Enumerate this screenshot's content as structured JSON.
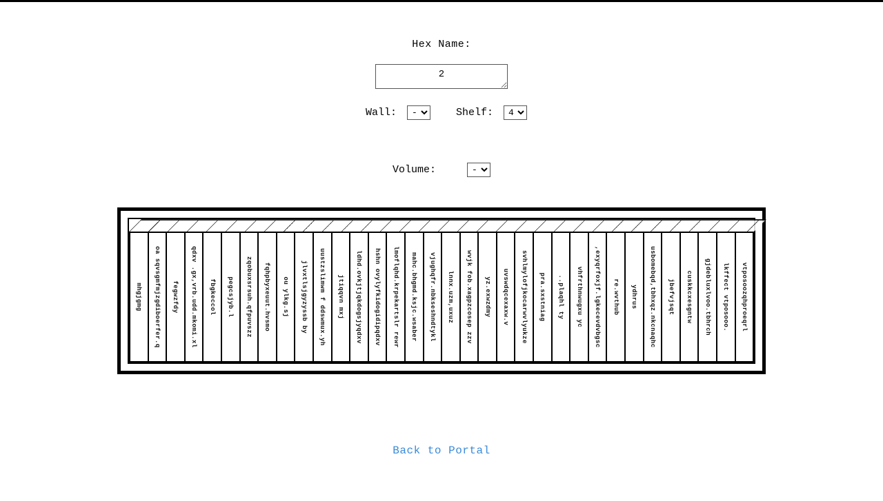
{
  "labels": {
    "hex": "Hex Name:",
    "wall": "Wall:",
    "shelf": "Shelf:",
    "volume": "Volume:"
  },
  "values": {
    "hex": "2",
    "wall": "-",
    "shelf": "4",
    "volume": "-"
  },
  "link": {
    "back": "Back to Portal"
  },
  "books": [
    "mhgjgmg",
    "oa sqvsgmfmjzgdiboerfer.q",
    "fegwzfdy",
    "qdxv .gx,vrb.udd.mkomi.xl",
    "fbgkeccol",
    "pegcsjyb.l",
    "zqobuxsrsuh.qfpuvszz",
    "fqhpbyxeuut.hvsmo",
    "ou ylkg.sj",
    "jlvxtlsjgyzyssb by",
    "uustzslimwm f ddswmux.yh",
    "jtiqqvn mxj",
    "ldhd.ovkjtjqkdogsjyqdxv",
    "hshn ovylyfkidogidipqdxv",
    "lmoflqhd.krpekartslr rewr",
    "mahc.bhgmd.ksjc.wsaber",
    "vjughqfr.nbkseshndtykl",
    "lnnx.uzm,uxuz",
    "wvjk fob.xagpzcosep zzv",
    "yz.exwzdmy",
    "uvswdqcexaxw.v",
    "svhlmylofjkocarwvlyukze",
    "pra.sxstniag",
    "..plaqhl ty",
    "vhfrthnwugxu yc",
    ",exyqrfoxjf.lgkecevdvbgsc",
    "re.wvthub",
    "ydhrus",
    "usbomebqd,tbhxqz.nkcnaqhc",
    "jbefvjsqt",
    "cuskkcxesgntw",
    "gjdebluxlvoo.tbhrch",
    "lkffect vtposooo.",
    "vtposoozqhproeqrl"
  ]
}
